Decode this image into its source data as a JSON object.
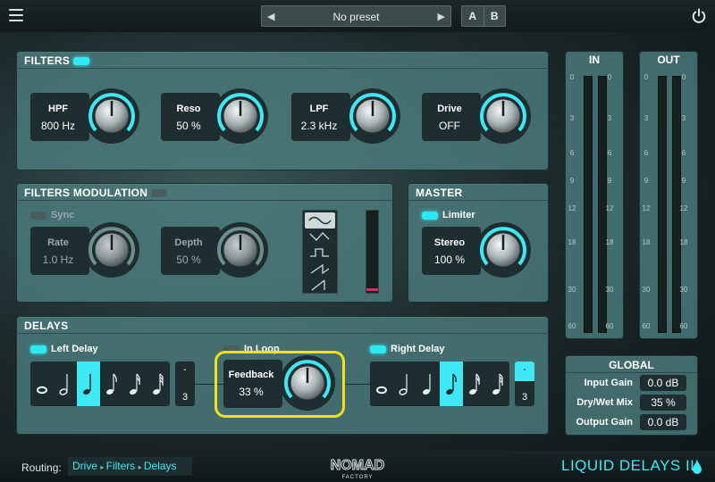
{
  "topbar": {
    "preset_name": "No preset",
    "ab": [
      "A",
      "B"
    ]
  },
  "filters": {
    "title": "FILTERS",
    "enabled": true,
    "controls": [
      {
        "label": "HPF",
        "value": "800 Hz"
      },
      {
        "label": "Reso",
        "value": "50 %"
      },
      {
        "label": "LPF",
        "value": "2.3 kHz"
      },
      {
        "label": "Drive",
        "value": "OFF"
      }
    ]
  },
  "filters_modulation": {
    "title": "FILTERS MODULATION",
    "enabled": false,
    "sync_label": "Sync",
    "rate": {
      "label": "Rate",
      "value": "1.0 Hz"
    },
    "depth": {
      "label": "Depth",
      "value": "50 %"
    },
    "waveforms": [
      "sine",
      "triangle",
      "square",
      "saw-up",
      "saw-down"
    ],
    "selected_waveform": "sine"
  },
  "master": {
    "title": "MASTER",
    "limiter_label": "Limiter",
    "limiter_on": true,
    "stereo": {
      "label": "Stereo",
      "value": "100 %"
    }
  },
  "meters": {
    "in_title": "IN",
    "out_title": "OUT",
    "scale": [
      "0",
      "3",
      "6",
      "9",
      "12",
      "18",
      "30",
      "60"
    ]
  },
  "global": {
    "title": "GLOBAL",
    "rows": [
      {
        "label": "Input Gain",
        "value": "0.0 dB"
      },
      {
        "label": "Dry/Wet Mix",
        "value": "35 %"
      },
      {
        "label": "Output Gain",
        "value": "0.0 dB"
      }
    ]
  },
  "delays": {
    "title": "DELAYS",
    "left_label": "Left Delay",
    "right_label": "Right Delay",
    "in_loop_label": "In Loop",
    "feedback": {
      "label": "Feedback",
      "value": "33 %"
    },
    "triplet_number": "3",
    "left_selected_note": 2,
    "right_selected_note": 3
  },
  "bottom": {
    "routing_label": "Routing:",
    "routing_chain": [
      "Drive",
      "Filters",
      "Delays"
    ],
    "logo_text": "NOMAD",
    "logo_sub": "FACTORY",
    "brand": "LIQUID DELAYS III"
  },
  "colors": {
    "accent": "#3ee8f4",
    "highlight": "#f2e218",
    "panel": "#4e8082"
  }
}
